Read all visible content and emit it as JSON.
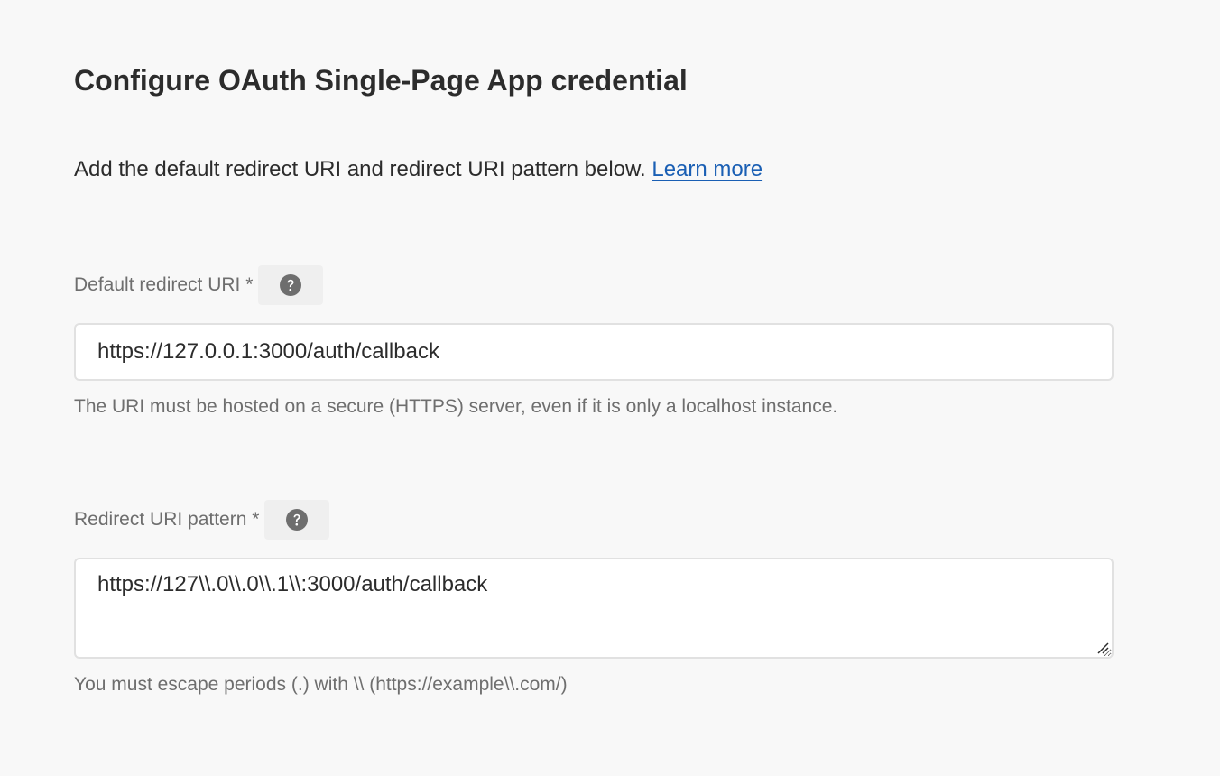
{
  "title": "Configure OAuth Single-Page App credential",
  "intro": {
    "text": "Add the default redirect URI and redirect URI pattern below. ",
    "link_label": "Learn more"
  },
  "default_redirect": {
    "label": "Default redirect URI *",
    "help_icon": "question-circle-icon",
    "value": "https://127.0.0.1:3000/auth/callback",
    "help_text": "The URI must be hosted on a secure (HTTPS) server, even if it is only a localhost instance."
  },
  "redirect_pattern": {
    "label": "Redirect URI pattern *",
    "help_icon": "question-circle-icon",
    "value": "https://127\\\\.0\\\\.0\\\\.1\\\\:3000/auth/callback",
    "help_text": "You must escape periods (.) with \\\\ (https://example\\\\.com/)"
  },
  "colors": {
    "background": "#f8f8f8",
    "text": "#2c2c2c",
    "muted": "#6e6e6e",
    "link": "#1a5fb4",
    "input_border": "#e1e1e1"
  }
}
